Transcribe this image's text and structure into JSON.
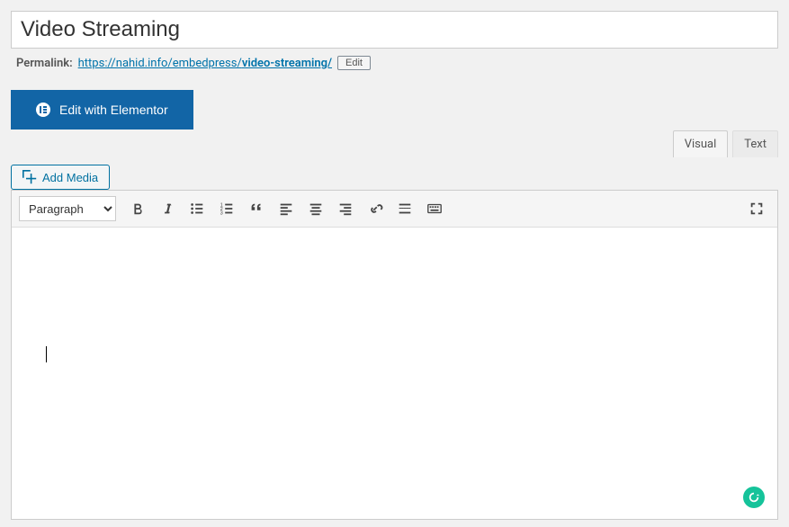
{
  "title": {
    "value": "Video Streaming"
  },
  "permalink": {
    "label": "Permalink:",
    "url_base": "https://nahid.info/embedpress/",
    "slug": "video-streaming/",
    "edit_label": "Edit"
  },
  "elementor": {
    "label": "Edit with Elementor"
  },
  "media": {
    "add_label": "Add Media"
  },
  "tabs": {
    "visual": "Visual",
    "text": "Text"
  },
  "toolbar": {
    "format_selected": "Paragraph"
  }
}
